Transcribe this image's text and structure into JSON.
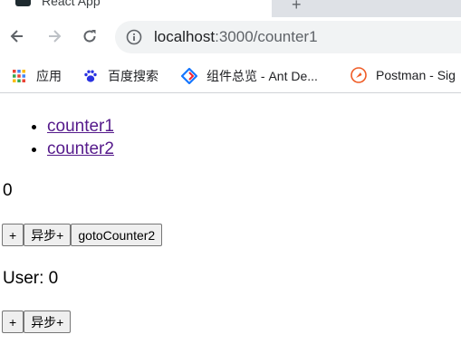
{
  "browser": {
    "tab": {
      "title": "React App",
      "close_glyph": "×",
      "new_tab_glyph": "+"
    },
    "omnibox": {
      "host": "localhost",
      "path": ":3000/counter1"
    },
    "bookmarks": [
      {
        "label": "应用",
        "icon": "apps-grid-icon"
      },
      {
        "label": "百度搜索",
        "icon": "baidu-paw-icon"
      },
      {
        "label": "组件总览 - Ant De...",
        "icon": "ant-design-icon"
      },
      {
        "label": "Postman - Sig",
        "icon": "postman-icon"
      }
    ]
  },
  "app": {
    "nav_links": [
      "counter1",
      "counter2"
    ],
    "counter": {
      "value": "0",
      "buttons": {
        "increment": "+",
        "async_increment": "异步+",
        "goto": "gotoCounter2"
      }
    },
    "user": {
      "label": "User: 0",
      "buttons": {
        "increment": "+",
        "async_increment": "异步+"
      }
    }
  },
  "colors": {
    "link_visited": "#551a8b",
    "tabstrip_bg": "#dee1e6",
    "omnibox_bg": "#f1f3f4"
  }
}
